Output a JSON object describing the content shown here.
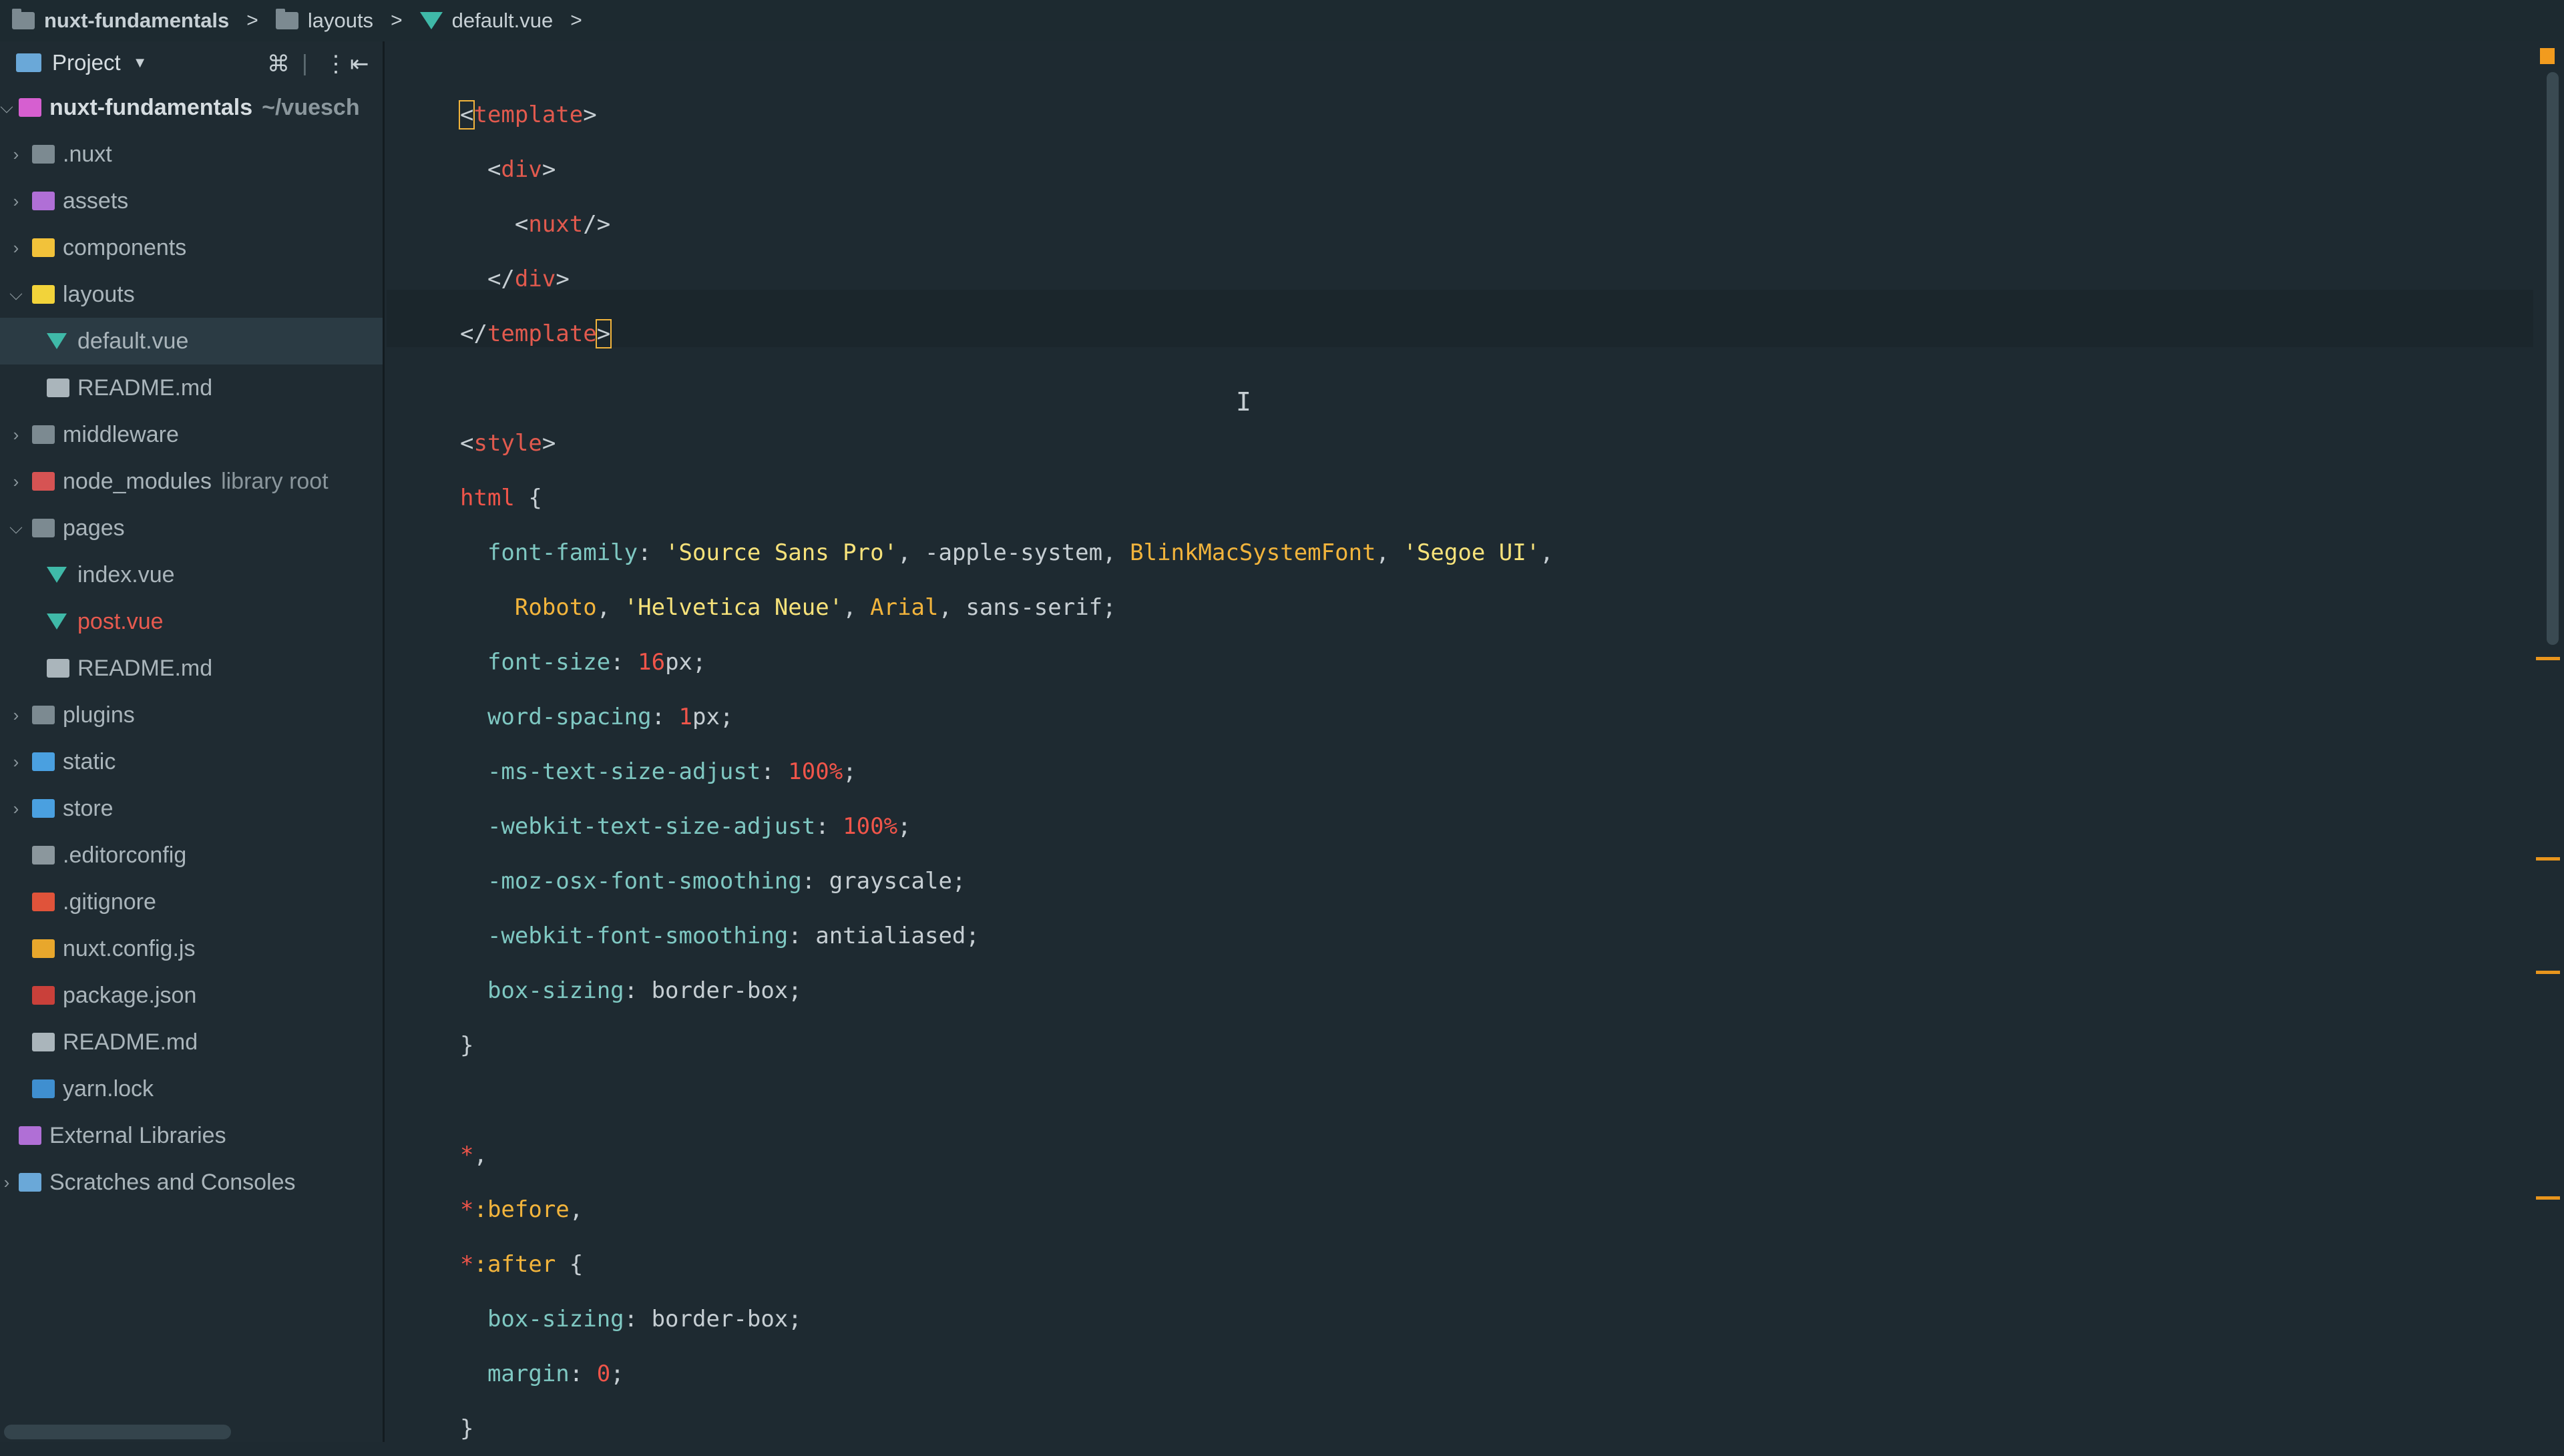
{
  "breadcrumb": {
    "project": "nuxt-fundamentals",
    "folder": "layouts",
    "file": "default.vue",
    "separator": ">"
  },
  "sidebar": {
    "header": {
      "title": "Project",
      "icons": [
        "collapse-all-icon",
        "divider-icon",
        "more-options-icon",
        "hide-panel-icon"
      ]
    },
    "tree": [
      {
        "label": "nuxt-fundamentals",
        "suffix": "~/vuesch",
        "level": 0,
        "expanded": true,
        "icon": "module-folder-icon",
        "color": "#d6dde1",
        "bold": true
      },
      {
        "label": ".nuxt",
        "level": 1,
        "expanded": false,
        "icon": "folder-icon",
        "color": "#aab5bb"
      },
      {
        "label": "assets",
        "level": 1,
        "expanded": false,
        "icon": "resources-folder-icon",
        "color": "#aab5bb"
      },
      {
        "label": "components",
        "level": 1,
        "expanded": false,
        "icon": "components-folder-icon",
        "color": "#aab5bb"
      },
      {
        "label": "layouts",
        "level": 1,
        "expanded": true,
        "icon": "layouts-folder-icon",
        "color": "#aab5bb"
      },
      {
        "label": "default.vue",
        "level": 2,
        "icon": "vue-file-icon",
        "color": "#aab5bb",
        "selected": true
      },
      {
        "label": "README.md",
        "level": 2,
        "icon": "markdown-file-icon",
        "color": "#aab5bb"
      },
      {
        "label": "middleware",
        "level": 1,
        "expanded": false,
        "icon": "folder-icon",
        "color": "#aab5bb"
      },
      {
        "label": "node_modules",
        "suffix": "library root",
        "level": 1,
        "expanded": false,
        "icon": "excluded-folder-icon",
        "color": "#aab5bb"
      },
      {
        "label": "pages",
        "level": 1,
        "expanded": true,
        "icon": "open-folder-icon",
        "color": "#aab5bb"
      },
      {
        "label": "index.vue",
        "level": 2,
        "icon": "vue-file-icon",
        "color": "#aab5bb"
      },
      {
        "label": "post.vue",
        "level": 2,
        "icon": "vue-file-icon",
        "color": "#e85a4f"
      },
      {
        "label": "README.md",
        "level": 2,
        "icon": "markdown-file-icon",
        "color": "#aab5bb"
      },
      {
        "label": "plugins",
        "level": 1,
        "expanded": false,
        "icon": "folder-icon",
        "color": "#aab5bb"
      },
      {
        "label": "static",
        "level": 1,
        "expanded": false,
        "icon": "web-folder-icon",
        "color": "#aab5bb"
      },
      {
        "label": "store",
        "level": 1,
        "expanded": false,
        "icon": "store-folder-icon",
        "color": "#aab5bb"
      },
      {
        "label": ".editorconfig",
        "level": 1,
        "icon": "editorconfig-icon",
        "color": "#aab5bb"
      },
      {
        "label": ".gitignore",
        "level": 1,
        "icon": "git-icon",
        "color": "#aab5bb"
      },
      {
        "label": "nuxt.config.js",
        "level": 1,
        "icon": "js-file-icon",
        "color": "#aab5bb"
      },
      {
        "label": "package.json",
        "level": 1,
        "icon": "npm-icon",
        "color": "#aab5bb"
      },
      {
        "label": "README.md",
        "level": 1,
        "icon": "markdown-file-icon",
        "color": "#aab5bb"
      },
      {
        "label": "yarn.lock",
        "level": 1,
        "icon": "yarn-icon",
        "color": "#aab5bb"
      },
      {
        "label": "External Libraries",
        "level": 0,
        "icon": "libraries-icon",
        "color": "#aab5bb",
        "noarrow": true
      },
      {
        "label": "Scratches and Consoles",
        "level": 0,
        "expanded": false,
        "icon": "scratches-icon",
        "color": "#aab5bb"
      }
    ]
  },
  "editor": {
    "cursor_glyph": "I",
    "lines": [
      [
        [
          "t-br",
          "<"
        ],
        [
          "t-tag",
          "template"
        ],
        [
          "t-br",
          ">"
        ]
      ],
      [
        [
          "t-br",
          "  <"
        ],
        [
          "t-tag",
          "div"
        ],
        [
          "t-br",
          ">"
        ]
      ],
      [
        [
          "t-br",
          "    <"
        ],
        [
          "t-tag",
          "nuxt"
        ],
        [
          "t-br",
          "/>"
        ]
      ],
      [
        [
          "t-br",
          "  </"
        ],
        [
          "t-tag",
          "div"
        ],
        [
          "t-br",
          ">"
        ]
      ],
      [
        [
          "t-br",
          "</"
        ],
        [
          "t-tag",
          "template"
        ],
        [
          "t-br",
          ">"
        ]
      ],
      [],
      [
        [
          "t-br",
          "<"
        ],
        [
          "t-tag",
          "style"
        ],
        [
          "t-br",
          ">"
        ]
      ],
      [
        [
          "t-sel",
          "html"
        ],
        [
          "t-punc",
          " {"
        ]
      ],
      [
        [
          "t-prop",
          "  font-family"
        ],
        [
          "t-punc",
          ": "
        ],
        [
          "t-str",
          "'Source Sans Pro'"
        ],
        [
          "t-punc",
          ", -apple-system, "
        ],
        [
          "t-font",
          "BlinkMacSystemFont"
        ],
        [
          "t-punc",
          ", "
        ],
        [
          "t-str",
          "'Segoe UI'"
        ],
        [
          "t-punc",
          ","
        ]
      ],
      [
        [
          "t-punc",
          "    "
        ],
        [
          "t-font",
          "Roboto"
        ],
        [
          "t-punc",
          ", "
        ],
        [
          "t-str",
          "'Helvetica Neue'"
        ],
        [
          "t-punc",
          ", "
        ],
        [
          "t-font",
          "Arial"
        ],
        [
          "t-punc",
          ", sans-serif;"
        ]
      ],
      [
        [
          "t-prop",
          "  font-size"
        ],
        [
          "t-punc",
          ": "
        ],
        [
          "t-num",
          "16"
        ],
        [
          "t-punc",
          "px;"
        ]
      ],
      [
        [
          "t-prop",
          "  word-spacing"
        ],
        [
          "t-punc",
          ": "
        ],
        [
          "t-num",
          "1"
        ],
        [
          "t-punc",
          "px;"
        ]
      ],
      [
        [
          "t-prop",
          "  -ms-text-size-adjust"
        ],
        [
          "t-punc",
          ": "
        ],
        [
          "t-num",
          "100%"
        ],
        [
          "t-punc",
          ";"
        ]
      ],
      [
        [
          "t-prop",
          "  -webkit-text-size-adjust"
        ],
        [
          "t-punc",
          ": "
        ],
        [
          "t-num",
          "100%"
        ],
        [
          "t-punc",
          ";"
        ]
      ],
      [
        [
          "t-prop",
          "  -moz-osx-font-smoothing"
        ],
        [
          "t-punc",
          ": grayscale;"
        ]
      ],
      [
        [
          "t-prop",
          "  -webkit-font-smoothing"
        ],
        [
          "t-punc",
          ": antialiased;"
        ]
      ],
      [
        [
          "t-prop",
          "  box-sizing"
        ],
        [
          "t-punc",
          ": border-box;"
        ]
      ],
      [
        [
          "t-punc",
          "}"
        ]
      ],
      [],
      [
        [
          "t-sel",
          "*"
        ],
        [
          "t-punc",
          ","
        ]
      ],
      [
        [
          "t-sel",
          "*"
        ],
        [
          "t-pseudo",
          ":before"
        ],
        [
          "t-punc",
          ","
        ]
      ],
      [
        [
          "t-sel",
          "*"
        ],
        [
          "t-pseudo",
          ":after"
        ],
        [
          "t-punc",
          " {"
        ]
      ],
      [
        [
          "t-prop",
          "  box-sizing"
        ],
        [
          "t-punc",
          ": border-box;"
        ]
      ],
      [
        [
          "t-prop",
          "  margin"
        ],
        [
          "t-punc",
          ": "
        ],
        [
          "t-num",
          "0"
        ],
        [
          "t-punc",
          ";"
        ]
      ],
      [
        [
          "t-punc",
          "}"
        ]
      ]
    ]
  },
  "colors": {
    "background": "#1e2a31",
    "tag": "#e25a4e",
    "property": "#7fc8c2",
    "string": "#f7e27a",
    "number": "#f0554a",
    "warning": "#f29b1e"
  }
}
